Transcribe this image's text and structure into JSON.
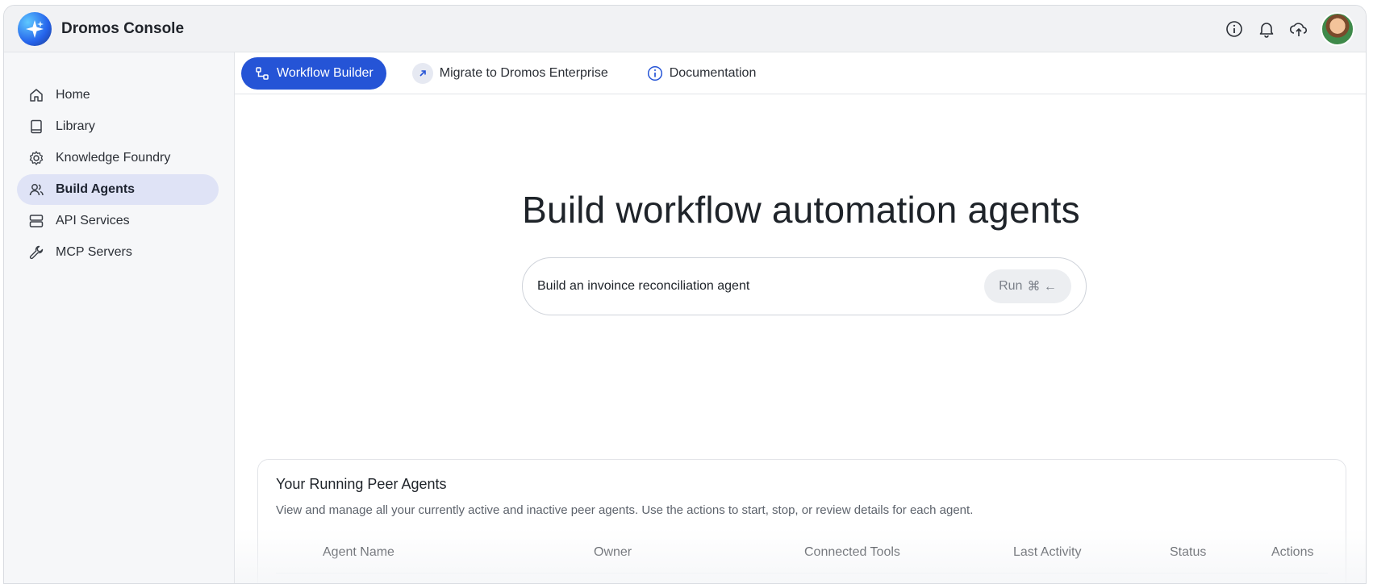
{
  "app": {
    "title": "Dromos Console"
  },
  "topbar": {
    "icons": [
      "info-icon",
      "bell-icon",
      "cloud-upload-icon"
    ],
    "avatar": "user-avatar"
  },
  "sidebar": {
    "items": [
      {
        "label": "Home",
        "icon": "home-icon",
        "active": false
      },
      {
        "label": "Library",
        "icon": "book-icon",
        "active": false
      },
      {
        "label": "Knowledge Foundry",
        "icon": "gear-icon",
        "active": false
      },
      {
        "label": "Build Agents",
        "icon": "users-icon",
        "active": true
      },
      {
        "label": "API Services",
        "icon": "server-icon",
        "active": false
      },
      {
        "label": "MCP Servers",
        "icon": "wrench-icon",
        "active": false
      }
    ]
  },
  "tabs": [
    {
      "label": "Workflow Builder",
      "icon": "workflow-icon",
      "active": true
    },
    {
      "label": "Migrate to Dromos Enterprise",
      "icon": "arrow-up-right-icon",
      "active": false
    },
    {
      "label": "Documentation",
      "icon": "info-icon",
      "active": false
    }
  ],
  "hero": {
    "title": "Build workflow automation agents"
  },
  "prompt": {
    "value": "Build an invoince reconciliation agent",
    "run_label": "Run",
    "shortcut": "⌘ ←"
  },
  "agents": {
    "title": "Your Running Peer Agents",
    "description": "View and manage all your currently active and inactive peer agents. Use the actions to start, stop, or review details for each agent.",
    "columns": [
      "Agent Name",
      "Owner",
      "Connected Tools",
      "Last Activity",
      "Status",
      "Actions"
    ]
  },
  "colors": {
    "accent": "#2554d6",
    "active_nav_bg": "#dfe3f6"
  }
}
